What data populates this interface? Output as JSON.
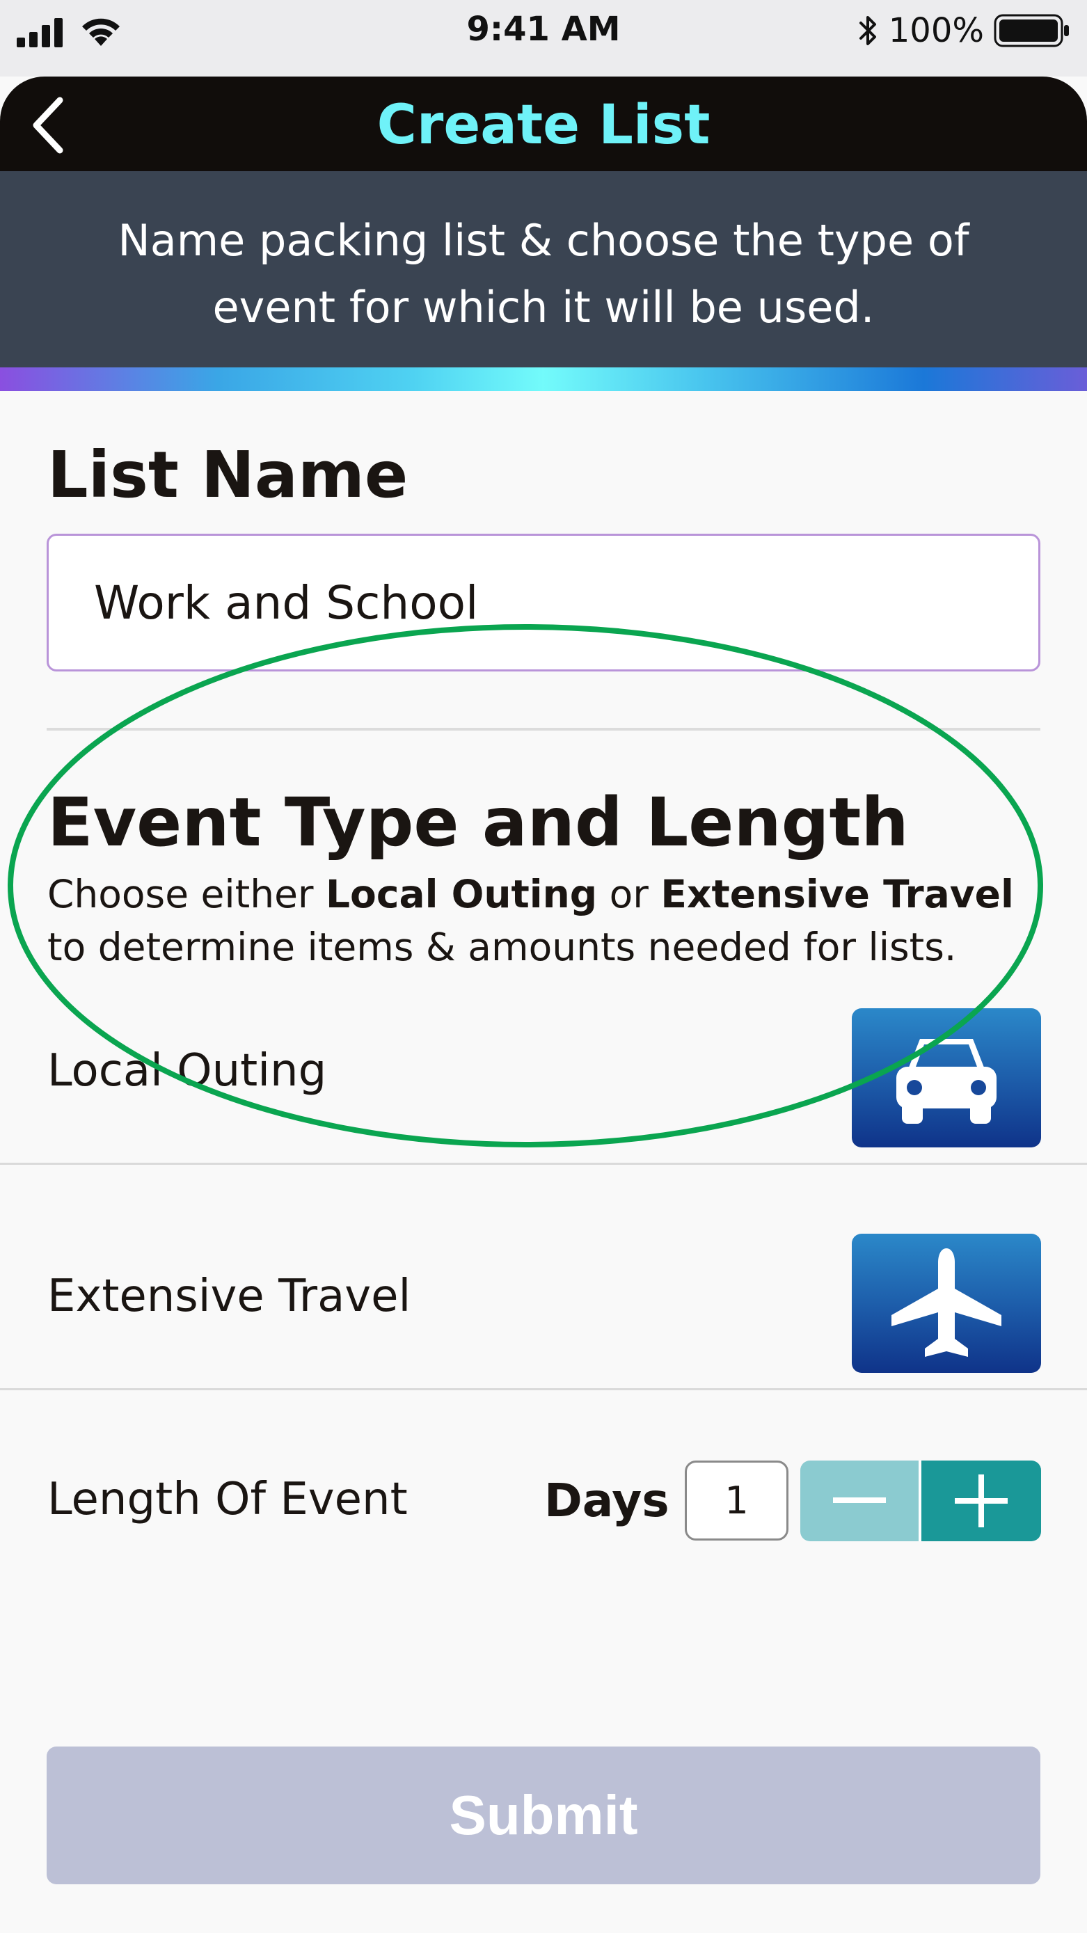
{
  "status_bar": {
    "time": "9:41 AM",
    "battery": "100%",
    "icons": [
      "cellular-signal-icon",
      "wifi-icon",
      "bluetooth-icon",
      "battery-icon"
    ]
  },
  "header": {
    "title": "Create List",
    "back_icon": "chevron-left-icon"
  },
  "banner": {
    "text": "Name packing list & choose the type of event for which it will be used."
  },
  "list_name": {
    "title": "List Name",
    "value": "Work and School"
  },
  "event": {
    "title": "Event Type and Length",
    "desc_prefix": "Choose either ",
    "desc_local": "Local Outing",
    "desc_or": " or ",
    "desc_extensive": "Extensive Travel",
    "desc_suffix": " to determine items & amounts needed for lists.",
    "options": [
      {
        "label": "Local Outing",
        "icon": "car-icon"
      },
      {
        "label": "Extensive Travel",
        "icon": "airplane-icon"
      }
    ],
    "length_label": "Length Of Event",
    "days_label": "Days",
    "days_value": "1"
  },
  "submit": {
    "label": "Submit"
  },
  "colors": {
    "accent_title": "#6ff2f8",
    "header_bg": "#110d0b",
    "banner_bg": "#3a4452",
    "icon_button": "#1c5aa8",
    "stepper_minus": "#8bcbd0",
    "stepper_plus": "#1a9898",
    "submit_disabled": "#bcc0d6",
    "annotation_circle": "#0aa550"
  }
}
